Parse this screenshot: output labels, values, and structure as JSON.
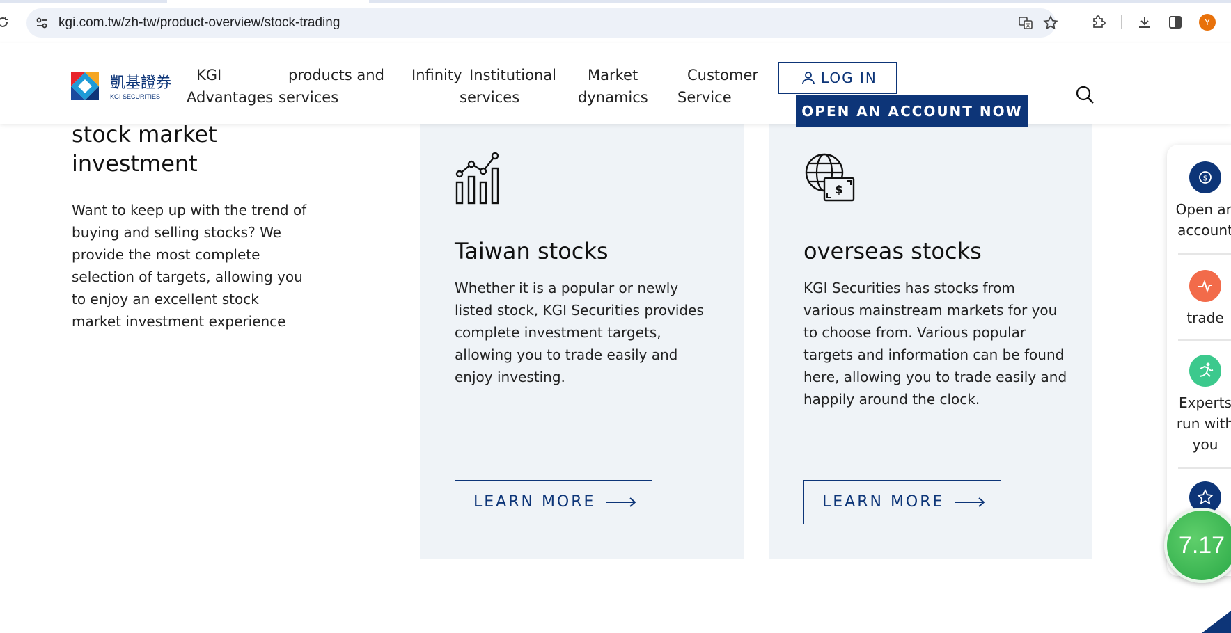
{
  "browser": {
    "url": "kgi.com.tw/zh-tw/product-overview/stock-trading",
    "profile_initial": "Y"
  },
  "header": {
    "logo_alt": "KGI SECURITIES",
    "logo_chinese": "凱基證券",
    "logo_english": "KGI SECURITIES",
    "nav": [
      {
        "line1": "KGI",
        "line2": "Advantages"
      },
      {
        "line1": "products and",
        "line2": "services"
      },
      {
        "line1": "Infinity",
        "line2": ""
      },
      {
        "line1": "Institutional",
        "line2": "services"
      },
      {
        "line1": "Market",
        "line2": "dynamics"
      },
      {
        "line1": "Customer",
        "line2": "Service"
      }
    ],
    "login_label": "LOG IN",
    "open_account_label": "OPEN AN ACCOUNT NOW"
  },
  "intro": {
    "title": "stock market investment",
    "text": "Want to keep up with the trend of buying and selling stocks? We provide the most complete selection of targets, allowing you to enjoy an excellent stock market investment experience"
  },
  "cards": [
    {
      "title": "Taiwan stocks",
      "text": "Whether it is a popular or newly listed stock, KGI Securities provides complete investment targets, allowing you to trade easily and enjoy investing.",
      "button": "LEARN MORE",
      "icon": "stock-chart-icon"
    },
    {
      "title": "overseas stocks",
      "text": "KGI Securities has stocks from various mainstream markets for you to choose from. Various popular targets and information can be found here, allowing you to trade easily and happily around the clock.",
      "button": "LEARN MORE",
      "icon": "globe-dollar-icon"
    }
  ],
  "float_panel": {
    "items": [
      {
        "label_line1": "Open an",
        "label_line2": "account",
        "icon": "dollar-icon",
        "color": "#0d3578"
      },
      {
        "label_line1": "trade",
        "label_line2": "",
        "icon": "pulse-icon",
        "color": "#f26b4a"
      },
      {
        "label_line1": "Experts",
        "label_line2": "run with",
        "label_line3": "you",
        "icon": "runner-icon",
        "color": "#3cc98d"
      },
      {
        "icon": "star-icon",
        "color": "#0d3578"
      }
    ],
    "score": "7.17"
  },
  "colors": {
    "brand_navy": "#0d3578",
    "card_bg": "#eff3f7"
  }
}
